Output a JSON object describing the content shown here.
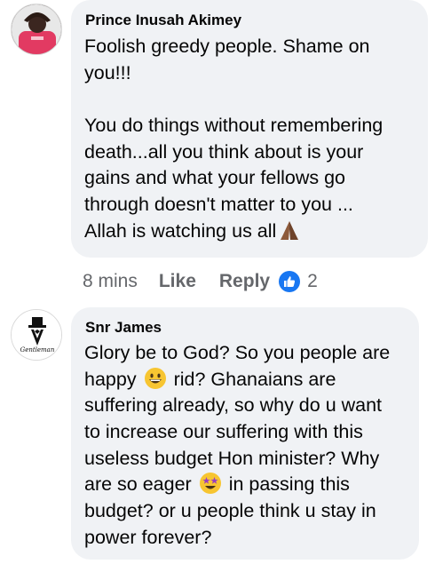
{
  "comments": [
    {
      "author": "Prince Inusah Akimey",
      "lines": [
        "Foolish greedy people. Shame on",
        "you!!!",
        "",
        "You do things without remembering",
        "death...all you think about is your",
        "gains and what your fellows go",
        "through doesn't matter to you ...",
        "Allah is watching us all"
      ],
      "emoji": "folded-hands",
      "meta": {
        "time": "8 mins",
        "like_label": "Like",
        "reply_label": "Reply",
        "reaction_count": "2"
      }
    },
    {
      "author": "Snr James",
      "avatar_text": "Gentleman",
      "lines": {
        "l1": "Glory be to God? So you people are",
        "l2a": "happy",
        "l2b": "rid? Ghanaians are",
        "l3": "suffering already, so why do u want",
        "l4": "to increase our suffering with this",
        "l5": "useless budget Hon minister? Why",
        "l6a": "are so eager",
        "l6b": "in passing this",
        "l7": "budget? or u people think u stay in",
        "l8": "power forever?"
      },
      "emojis": [
        "grinning-face",
        "star-struck"
      ]
    }
  ],
  "colors": {
    "bubble": "#f0f2f5",
    "meta_text": "#65676b",
    "like_blue": "#1877f2"
  }
}
